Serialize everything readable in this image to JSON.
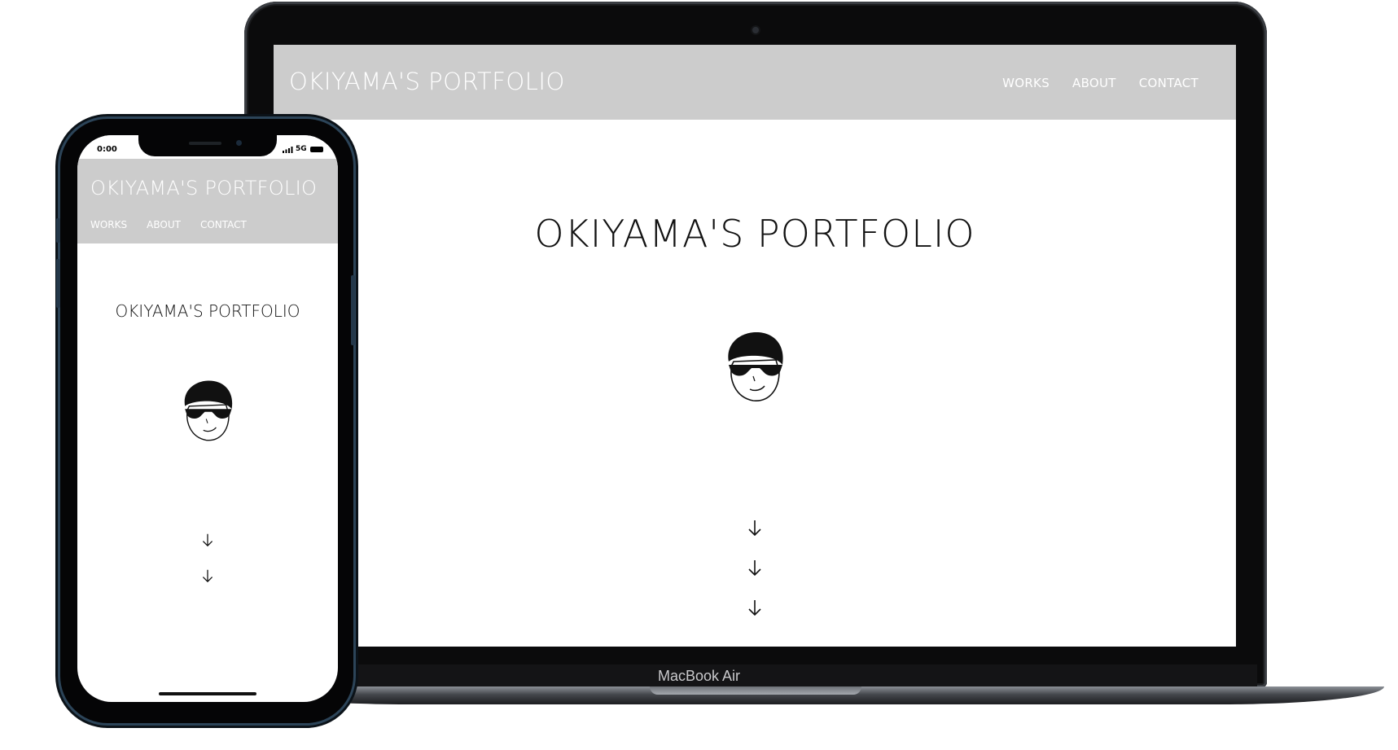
{
  "laptop": {
    "site_title": "OKIYAMA'S PORTFOLIO",
    "nav": [
      "WORKS",
      "ABOUT",
      "CONTACT"
    ],
    "hero_title": "OKIYAMA'S PORTFOLIO",
    "device_label": "MacBook Air",
    "avatar_icon": "avatar-face-sunglasses",
    "arrow_icon": "arrow-down-icon"
  },
  "phone": {
    "status": {
      "time": "0:00",
      "network": "5G"
    },
    "site_title": "OKIYAMA'S PORTFOLIO",
    "nav": [
      "WORKS",
      "ABOUT",
      "CONTACT"
    ],
    "hero_title": "OKIYAMA'S PORTFOLIO",
    "avatar_icon": "avatar-face-sunglasses",
    "arrow_icon": "arrow-down-icon"
  },
  "colors": {
    "header_bg": "#cccccc",
    "header_text": "#ffffff",
    "body_text": "#111111",
    "page_bg": "#ffffff"
  }
}
